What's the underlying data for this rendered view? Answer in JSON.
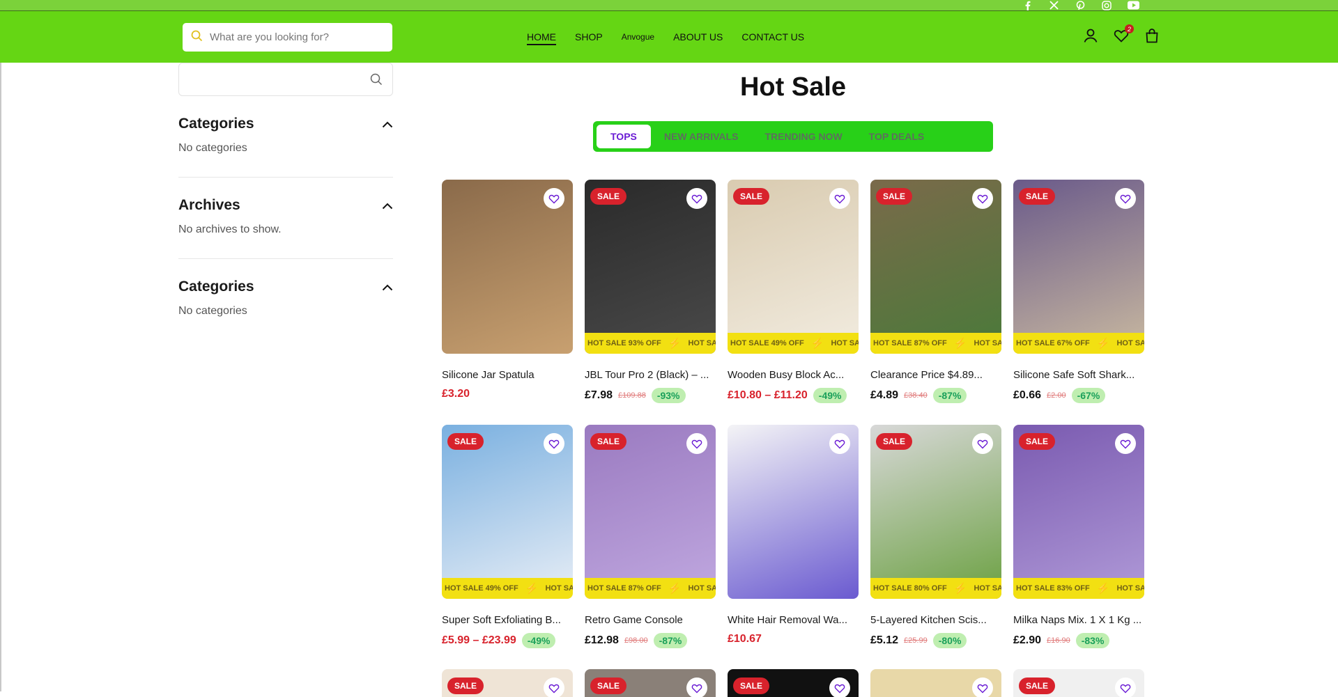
{
  "header": {
    "search_placeholder": "What are you looking for?",
    "nav": [
      {
        "label": "HOME"
      },
      {
        "label": "SHOP"
      },
      {
        "label": "Anvogue"
      },
      {
        "label": "ABOUT US"
      },
      {
        "label": "CONTACT US"
      }
    ],
    "wishlist_count": "2",
    "social_icons": [
      "facebook-icon",
      "x-icon",
      "pinterest-icon",
      "instagram-icon",
      "youtube-icon"
    ]
  },
  "sidebar": {
    "sections": [
      {
        "title": "Categories",
        "text": "No categories"
      },
      {
        "title": "Archives",
        "text": "No archives to show."
      },
      {
        "title": "Categories",
        "text": "No categories"
      }
    ]
  },
  "main": {
    "title": "Hot Sale",
    "tabs": [
      {
        "label": "TOPS",
        "active": true
      },
      {
        "label": "NEW ARRIVALS",
        "active": false
      },
      {
        "label": "TRENDING NOW",
        "active": false
      },
      {
        "label": "TOP DEALS",
        "active": false
      }
    ],
    "sale_label": "SALE",
    "products": [
      {
        "name": "Silicone Jar Spatula",
        "price": "£3.20",
        "old": "",
        "discount": "",
        "sale": false,
        "strip": "",
        "price_red": true,
        "img": "#8a6a4a,#c8a070"
      },
      {
        "name": "JBL Tour Pro 2 (Black) – ...",
        "price": "£7.98",
        "old": "£109.88",
        "discount": "-93%",
        "sale": true,
        "strip": "HOT SALE 93% OFF",
        "price_red": false,
        "img": "#2a2a2a,#4a4a4a"
      },
      {
        "name": "Wooden Busy Block Ac...",
        "price": "£10.80 – £11.20",
        "old": "",
        "discount": "-49%",
        "sale": true,
        "strip": "HOT SALE 49% OFF",
        "price_red": true,
        "img": "#d9cbb0,#f2ece0"
      },
      {
        "name": "Clearance Price $4.89...",
        "price": "£4.89",
        "old": "£38.40",
        "discount": "-87%",
        "sale": true,
        "strip": "HOT SALE 87% OFF",
        "price_red": false,
        "img": "#7a6a4a,#4a7a3a"
      },
      {
        "name": "Silicone Safe Soft Shark...",
        "price": "£0.66",
        "old": "£2.00",
        "discount": "-67%",
        "sale": true,
        "strip": "HOT SALE 67% OFF",
        "price_red": false,
        "img": "#6a5a8a,#c9b9a0"
      },
      {
        "name": "Super Soft Exfoliating B...",
        "price": "£5.99 – £23.99",
        "old": "",
        "discount": "-49%",
        "sale": true,
        "strip": "HOT SALE 49% OFF",
        "price_red": true,
        "img": "#7ab0e0,#e8eef6"
      },
      {
        "name": "Retro Game Console",
        "price": "£12.98",
        "old": "£98.00",
        "discount": "-87%",
        "sale": true,
        "strip": "HOT SALE 87% OFF",
        "price_red": false,
        "img": "#9a7ac0,#c0a8e0"
      },
      {
        "name": "White Hair Removal Wa...",
        "price": "£10.67",
        "old": "",
        "discount": "",
        "sale": false,
        "strip": "",
        "price_red": true,
        "img": "#f4f4f6,#6a5ad0"
      },
      {
        "name": "5-Layered Kitchen Scis...",
        "price": "£5.12",
        "old": "£25.99",
        "discount": "-80%",
        "sale": true,
        "strip": "HOT SALE 80% OFF",
        "price_red": false,
        "img": "#d8d8d8,#6aa040"
      },
      {
        "name": "Milka Naps Mix. 1 X 1 Kg ...",
        "price": "£2.90",
        "old": "£16.90",
        "discount": "-83%",
        "sale": true,
        "strip": "HOT SALE 83% OFF",
        "price_red": false,
        "img": "#7a5ab0,#b09ad8"
      }
    ],
    "row3": [
      {
        "sale": true,
        "img": "#efe4d6"
      },
      {
        "sale": true,
        "img": "#8a8078"
      },
      {
        "sale": true,
        "img": "#111111"
      },
      {
        "sale": false,
        "img": "#e8d8a8"
      },
      {
        "sale": true,
        "img": "#f0f0f0"
      }
    ]
  }
}
